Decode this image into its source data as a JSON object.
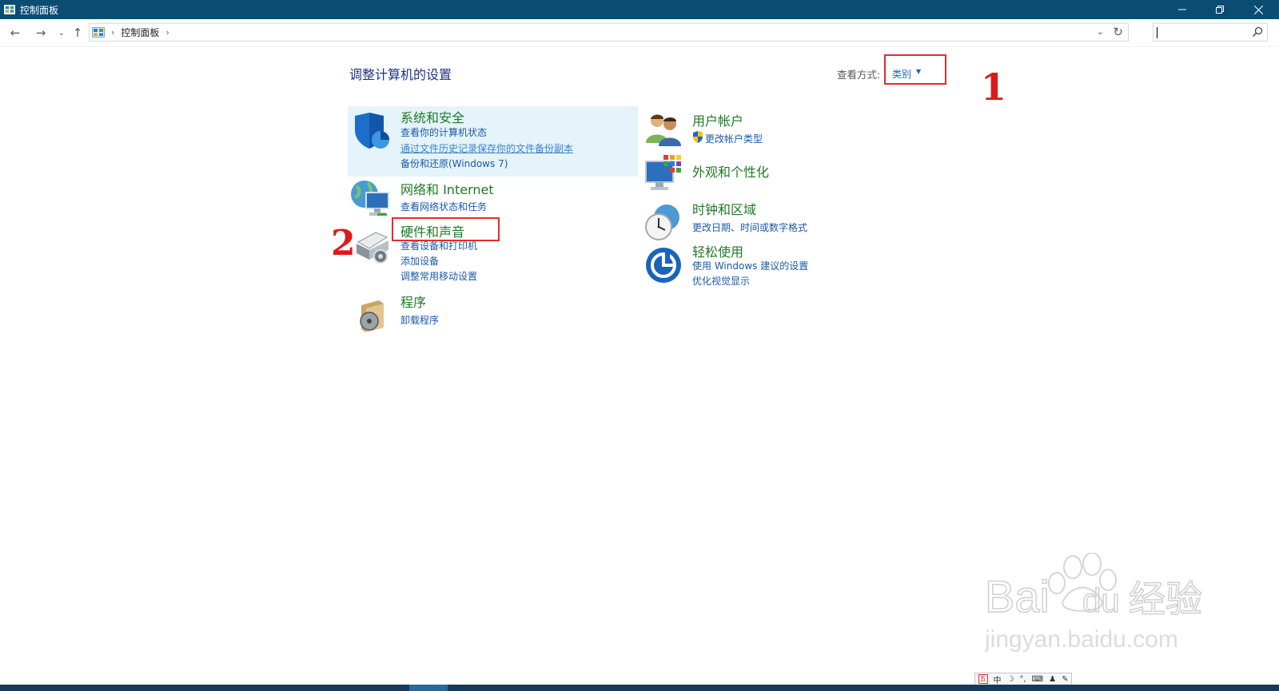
{
  "window": {
    "title": "控制面板"
  },
  "address": {
    "crumbs": [
      "控制面板"
    ]
  },
  "search": {
    "placeholder": ""
  },
  "content": {
    "heading": "调整计算机的设置",
    "view_by_label": "查看方式:",
    "view_by_value": "类别"
  },
  "categories": [
    {
      "title": "系统和安全",
      "icon": "shield-icon",
      "links": [
        "查看你的计算机状态",
        "通过文件历史记录保存你的文件备份副本",
        "备份和还原(Windows 7)"
      ]
    },
    {
      "title": "网络和 Internet",
      "icon": "network-globe-icon",
      "links": [
        "查看网络状态和任务"
      ]
    },
    {
      "title": "硬件和声音",
      "icon": "printer-icon",
      "links": [
        "查看设备和打印机",
        "添加设备",
        "调整常用移动设置"
      ]
    },
    {
      "title": "程序",
      "icon": "programs-disc-icon",
      "links": [
        "卸载程序"
      ]
    },
    {
      "title": "用户帐户",
      "icon": "users-icon",
      "links": [
        "更改帐户类型"
      ]
    },
    {
      "title": "外观和个性化",
      "icon": "monitor-palette-icon",
      "links": []
    },
    {
      "title": "时钟和区域",
      "icon": "clock-globe-icon",
      "links": [
        "更改日期、时间或数字格式"
      ]
    },
    {
      "title": "轻松使用",
      "icon": "ease-of-access-icon",
      "links": [
        "使用 Windows 建议的设置",
        "优化视觉显示"
      ]
    }
  ],
  "annotations": {
    "marker_1": "1",
    "marker_2": "2"
  },
  "watermark": {
    "brand": "Bai",
    "brand2": "du",
    "cn": "经验",
    "url": "jingyan.baidu.com"
  },
  "ime": {
    "mode": "中"
  },
  "colors": {
    "titlebar": "#0b4c73",
    "category_title": "#1f7a24",
    "link": "#1a5aa8",
    "annotation": "#e42b2b"
  }
}
